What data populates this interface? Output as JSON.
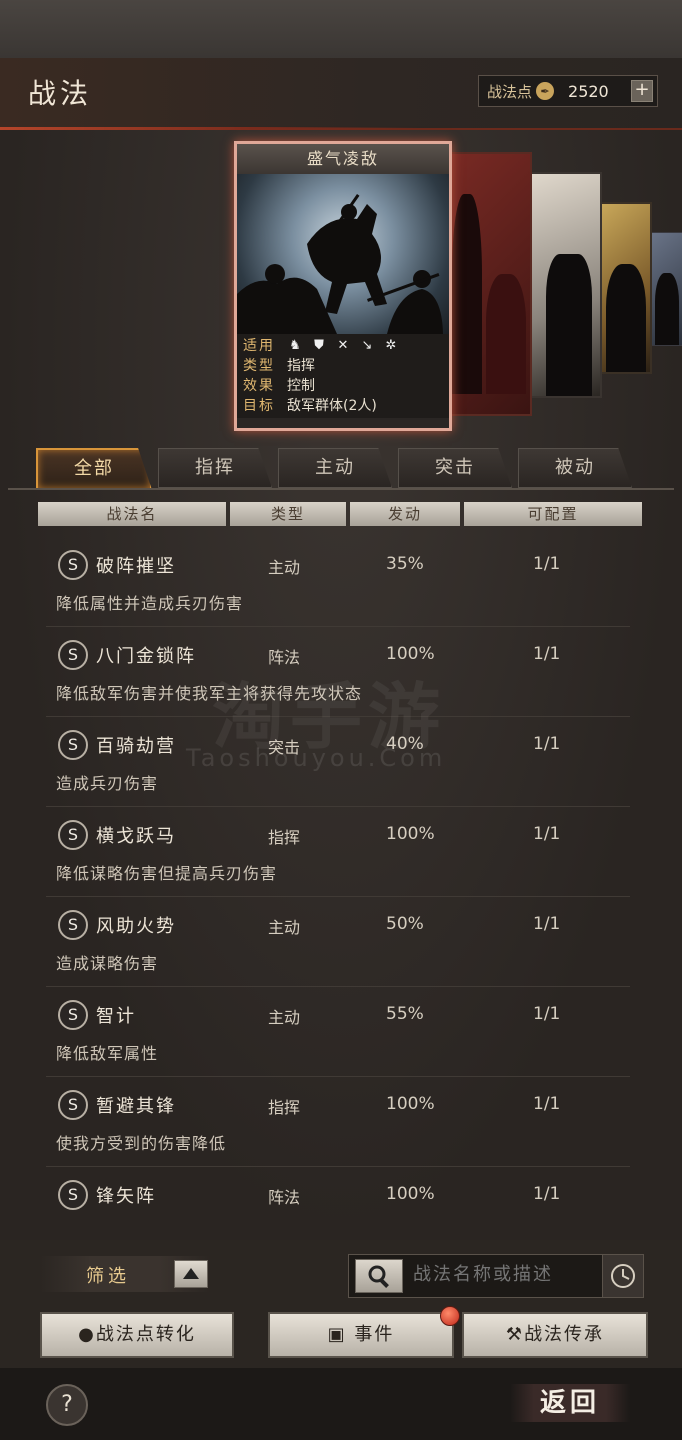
{
  "header": {
    "title": "战法",
    "points_label": "战法点",
    "points_value": "2520",
    "plus": "+"
  },
  "card": {
    "name": "盛气凌敌",
    "rows": [
      {
        "key": "适用",
        "value": ""
      },
      {
        "key": "类型",
        "value": "指挥"
      },
      {
        "key": "效果",
        "value": "控制"
      },
      {
        "key": "目标",
        "value": "敌军群体(2人)"
      }
    ],
    "applicable_icons": [
      "cavalry-icon",
      "shield-icon",
      "bow-icon",
      "spear-icon",
      "wheel-icon"
    ]
  },
  "tabs": [
    {
      "label": "全部",
      "active": true
    },
    {
      "label": "指挥",
      "active": false
    },
    {
      "label": "主动",
      "active": false
    },
    {
      "label": "突击",
      "active": false
    },
    {
      "label": "被动",
      "active": false
    }
  ],
  "columns": {
    "name": "战法名",
    "type": "类型",
    "trigger": "发动",
    "config": "可配置"
  },
  "skills": [
    {
      "grade": "S",
      "name": "破阵摧坚",
      "type": "主动",
      "trigger": "35%",
      "config": "1/1",
      "desc": "降低属性并造成兵刃伤害"
    },
    {
      "grade": "S",
      "name": "八门金锁阵",
      "type": "阵法",
      "trigger": "100%",
      "config": "1/1",
      "desc": "降低敌军伤害并使我军主将获得先攻状态"
    },
    {
      "grade": "S",
      "name": "百骑劫营",
      "type": "突击",
      "trigger": "40%",
      "config": "1/1",
      "desc": "造成兵刃伤害"
    },
    {
      "grade": "S",
      "name": "横戈跃马",
      "type": "指挥",
      "trigger": "100%",
      "config": "1/1",
      "desc": "降低谋略伤害但提高兵刃伤害"
    },
    {
      "grade": "S",
      "name": "风助火势",
      "type": "主动",
      "trigger": "50%",
      "config": "1/1",
      "desc": "造成谋略伤害"
    },
    {
      "grade": "S",
      "name": "智计",
      "type": "主动",
      "trigger": "55%",
      "config": "1/1",
      "desc": "降低敌军属性"
    },
    {
      "grade": "S",
      "name": "暂避其锋",
      "type": "指挥",
      "trigger": "100%",
      "config": "1/1",
      "desc": "使我方受到的伤害降低"
    },
    {
      "grade": "S",
      "name": "锋矢阵",
      "type": "阵法",
      "trigger": "100%",
      "config": "1/1",
      "desc": ""
    }
  ],
  "watermark": {
    "main": "淘手游",
    "sub": "Taoshouyou.Com"
  },
  "filter": {
    "label": "筛选"
  },
  "search": {
    "placeholder": "战法名称或描述"
  },
  "buttons": {
    "convert": "战法点转化",
    "events": "事件",
    "inherit": "战法传承"
  },
  "footer": {
    "help": "?",
    "back": "返回"
  }
}
